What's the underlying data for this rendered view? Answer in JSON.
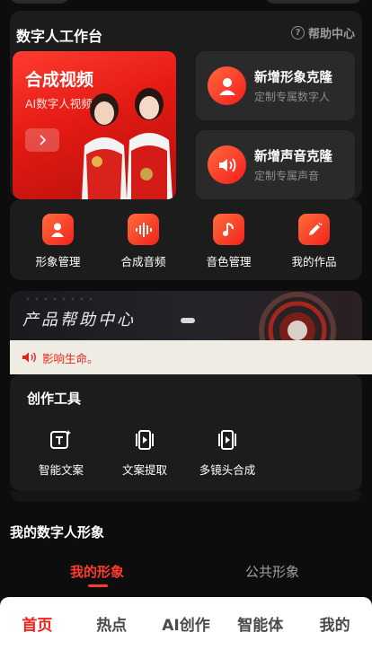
{
  "workspace": {
    "title": "数字人工作台",
    "help_label": "帮助中心",
    "synth_card": {
      "title": "合成视频",
      "subtitle": "AI数字人视频"
    },
    "clone_image": {
      "title": "新增形象克隆",
      "desc": "定制专属数字人"
    },
    "clone_voice": {
      "title": "新增声音克隆",
      "desc": "定制专属声音"
    }
  },
  "quick_actions": [
    {
      "label": "形象管理",
      "icon": "user-icon"
    },
    {
      "label": "合成音频",
      "icon": "waveform-icon"
    },
    {
      "label": "音色管理",
      "icon": "music-note-icon"
    },
    {
      "label": "我的作品",
      "icon": "edit-pen-icon"
    }
  ],
  "banner": {
    "title": "产品帮助中心"
  },
  "notice": {
    "text": "影响生命。"
  },
  "tools": {
    "title": "创作工具",
    "items": [
      {
        "label": "智能文案",
        "icon": "ai-text-icon"
      },
      {
        "label": "文案提取",
        "icon": "video-extract-icon"
      },
      {
        "label": "多镜头合成",
        "icon": "multi-shot-icon"
      }
    ]
  },
  "my_avatars": {
    "title": "我的数字人形象",
    "tabs": {
      "mine": "我的形象",
      "public": "公共形象"
    }
  },
  "bottom_nav": {
    "home": "首页",
    "hot": "热点",
    "ai": "AI创作",
    "agent": "智能体",
    "me": "我的"
  },
  "colors": {
    "accent": "#f2221c",
    "background": "#0d0d0d",
    "card": "#1c1c1c",
    "notice_bg": "#efece3"
  }
}
